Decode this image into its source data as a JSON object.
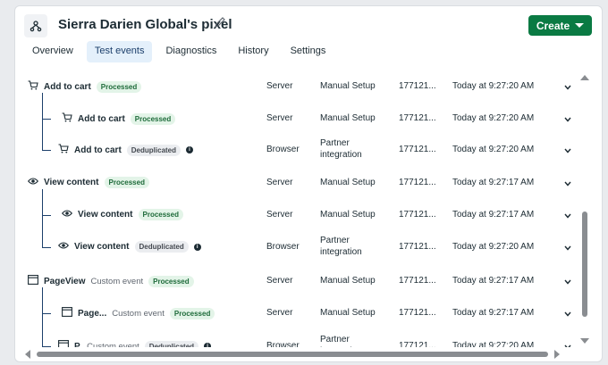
{
  "header": {
    "title": "Sierra Darien Global's pixel",
    "create_label": "Create"
  },
  "tabs": [
    {
      "label": "Overview",
      "active": false
    },
    {
      "label": "Test events",
      "active": true
    },
    {
      "label": "Diagnostics",
      "active": false
    },
    {
      "label": "History",
      "active": false
    },
    {
      "label": "Settings",
      "active": false
    }
  ],
  "events": [
    {
      "name": "Add to cart",
      "custom": "",
      "badge": "Processed",
      "source": "Server",
      "setup": "Manual Setup",
      "id": "177121...",
      "time": "Today at 9:27:20 AM",
      "icon": "cart-icon",
      "child": false
    },
    {
      "name": "Add to cart",
      "custom": "",
      "badge": "Processed",
      "source": "Server",
      "setup": "Manual Setup",
      "id": "177121...",
      "time": "Today at 9:27:20 AM",
      "icon": "cart-icon",
      "child": true
    },
    {
      "name": "Add to cart",
      "custom": "",
      "badge": "Deduplicated",
      "source": "Browser",
      "setup": "Partner integration",
      "id": "177121...",
      "time": "Today at 9:27:20 AM",
      "icon": "cart-icon",
      "child": true
    },
    {
      "name": "View content",
      "custom": "",
      "badge": "Processed",
      "source": "Server",
      "setup": "Manual Setup",
      "id": "177121...",
      "time": "Today at 9:27:17 AM",
      "icon": "eye-icon",
      "child": false
    },
    {
      "name": "View content",
      "custom": "",
      "badge": "Processed",
      "source": "Server",
      "setup": "Manual Setup",
      "id": "177121...",
      "time": "Today at 9:27:17 AM",
      "icon": "eye-icon",
      "child": true
    },
    {
      "name": "View content",
      "custom": "",
      "badge": "Deduplicated",
      "source": "Browser",
      "setup": "Partner integration",
      "id": "177121...",
      "time": "Today at 9:27:20 AM",
      "icon": "eye-icon",
      "child": true
    },
    {
      "name": "PageView",
      "custom": "Custom event",
      "badge": "Processed",
      "source": "Server",
      "setup": "Manual Setup",
      "id": "177121...",
      "time": "Today at 9:27:17 AM",
      "icon": "page-icon",
      "child": false
    },
    {
      "name": "Page...",
      "custom": "Custom event",
      "badge": "Processed",
      "source": "Server",
      "setup": "Manual Setup",
      "id": "177121...",
      "time": "Today at 9:27:17 AM",
      "icon": "page-icon",
      "child": true
    },
    {
      "name": "P.",
      "custom": "Custom event",
      "badge": "Deduplicated",
      "source": "Browser",
      "setup": "Partner integration",
      "id": "177121...",
      "time": "Today at 9:27:20 AM",
      "icon": "page-icon",
      "child": true
    }
  ],
  "colors": {
    "primary": "#0a7a43",
    "active_tab_bg": "#e4f0fb",
    "processed_bg": "#e3f4e8",
    "dedup_bg": "#ebedf0",
    "connector": "#1c3f6b"
  }
}
